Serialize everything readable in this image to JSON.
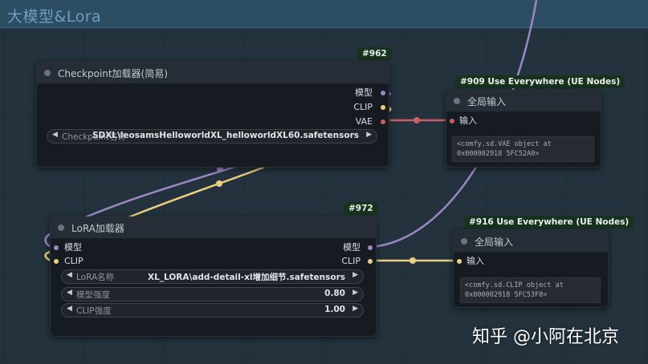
{
  "group": {
    "title": "大模型&Lora"
  },
  "colors": {
    "model_wire": "#9b87c4",
    "clip_wire": "#e9cf7e",
    "vae_wire": "#c86166",
    "badge_bg": "#17321f"
  },
  "checkpoint_node": {
    "badge": "#962",
    "title": "Checkpoint加载器(简易)",
    "outputs": [
      "模型",
      "CLIP",
      "VAE"
    ],
    "widget": {
      "label": "Checkpoint名称",
      "value": "SDXL\\leosamsHelloworldXL_helloworldXL60.safetensors"
    }
  },
  "lora_node": {
    "badge": "#972",
    "title": "LoRA加载器",
    "inputs": [
      "模型",
      "CLIP"
    ],
    "outputs": [
      "模型",
      "CLIP"
    ],
    "widgets": [
      {
        "label": "LoRA名称",
        "value": "XL_LORA\\add-detail-xl增加细节.safetensors"
      },
      {
        "label": "模型强度",
        "value": "0.80"
      },
      {
        "label": "CLIP强度",
        "value": "1.00"
      }
    ]
  },
  "ue_vae_node": {
    "badge": "#909 Use Everywhere (UE Nodes)",
    "title": "全局输入",
    "input": "输入",
    "text": "<comfy.sd.VAE object at\n0x000002918 5FC52A0>"
  },
  "ue_clip_node": {
    "badge": "#916 Use Everywhere (UE Nodes)",
    "title": "全局输入",
    "input": "输入",
    "text": "<comfy.sd.CLIP object at\n0x000002918 5FC53F0>"
  },
  "watermark": "知乎 @小阿在北京"
}
